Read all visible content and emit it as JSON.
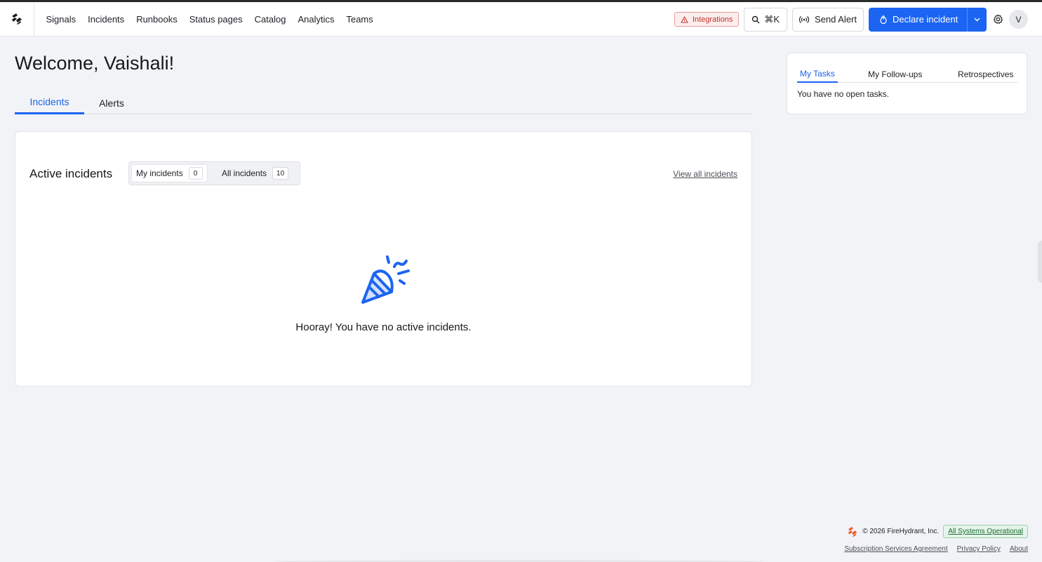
{
  "nav": {
    "links": [
      "Signals",
      "Incidents",
      "Runbooks",
      "Status pages",
      "Catalog",
      "Analytics",
      "Teams"
    ],
    "integrations_label": "Integrations",
    "search_shortcut": "⌘K",
    "send_alert_label": "Send Alert",
    "declare_label": "Declare incident",
    "avatar_initial": "V"
  },
  "main": {
    "welcome": "Welcome, Vaishali!",
    "tabs": [
      "Incidents",
      "Alerts"
    ],
    "active_tab": "Incidents",
    "card": {
      "title": "Active incidents",
      "filters": [
        {
          "label": "My incidents",
          "count": "0"
        },
        {
          "label": "All incidents",
          "count": "10"
        }
      ],
      "view_all": "View all incidents",
      "empty_message": "Hooray! You have no active incidents."
    }
  },
  "side": {
    "tabs": [
      "My Tasks",
      "My Follow-ups",
      "Retrospectives"
    ],
    "active_tab": "My Tasks",
    "empty_message": "You have no open tasks."
  },
  "footer": {
    "copyright": "© 2026 FireHydrant, Inc.",
    "status": "All Systems Operational",
    "links": [
      "Subscription Services Agreement",
      "Privacy Policy",
      "About"
    ]
  },
  "colors": {
    "primary": "#1c64f2",
    "logo_dark": "#17181c",
    "logo_orange": "#f05a28",
    "warning": "#c0302b",
    "success": "#1a6d31"
  }
}
